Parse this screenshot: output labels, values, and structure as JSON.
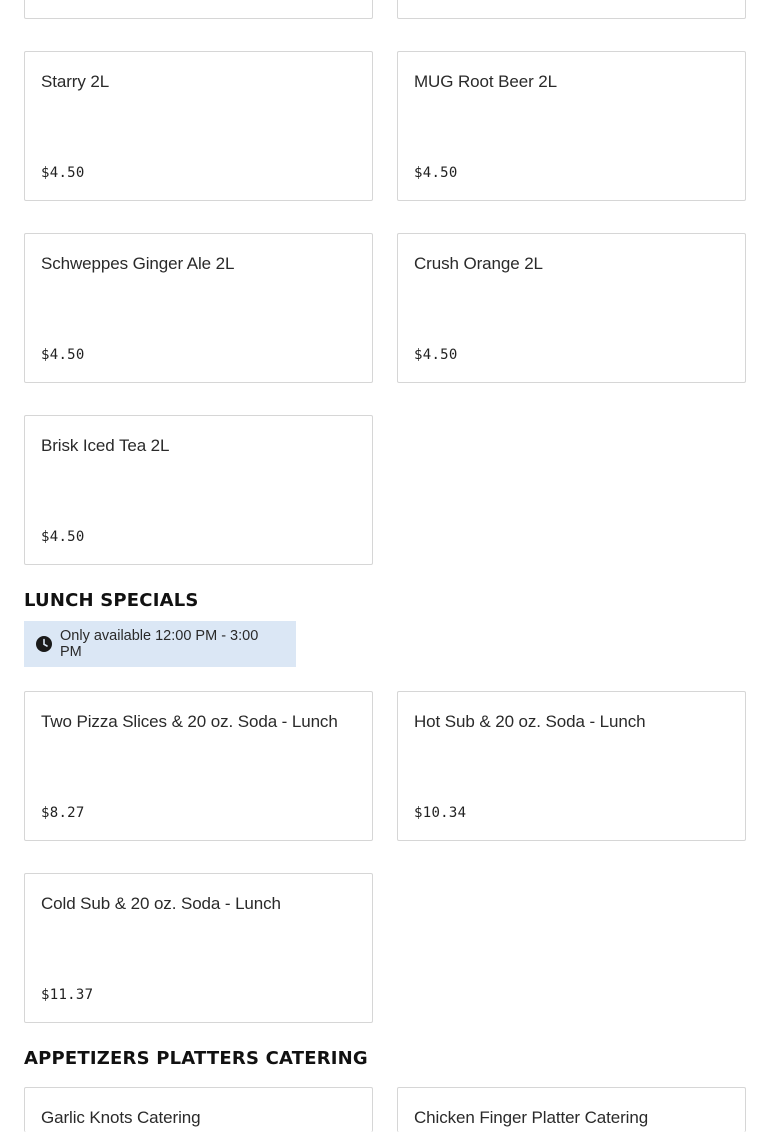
{
  "colors": {
    "availability_bg": "#dbe7f5",
    "card_border": "#d6d6d6",
    "text": "#1f1f1f"
  },
  "drinks": [
    {
      "name": "",
      "price": ""
    },
    {
      "name": "",
      "price": ""
    },
    {
      "name": "Starry 2L",
      "price": "$4.50"
    },
    {
      "name": "MUG Root Beer 2L",
      "price": "$4.50"
    },
    {
      "name": "Schweppes Ginger Ale 2L",
      "price": "$4.50"
    },
    {
      "name": "Crush Orange 2L",
      "price": "$4.50"
    },
    {
      "name": "Brisk Iced Tea 2L",
      "price": "$4.50"
    }
  ],
  "lunch_specials": {
    "title": "LUNCH SPECIALS",
    "availability": {
      "icon": "clock-icon",
      "text": "Only available 12:00 PM - 3:00 PM"
    },
    "items": [
      {
        "name": "Two Pizza Slices & 20 oz. Soda - Lunch",
        "price": "$8.27"
      },
      {
        "name": "Hot Sub & 20 oz. Soda - Lunch",
        "price": "$10.34"
      },
      {
        "name": "Cold Sub & 20 oz. Soda - Lunch",
        "price": "$11.37"
      }
    ]
  },
  "appetizers": {
    "title": "APPETIZERS PLATTERS CATERING",
    "items": [
      {
        "name": "Garlic Knots Catering",
        "price": ""
      },
      {
        "name": "Chicken Finger Platter Catering",
        "price": ""
      }
    ]
  }
}
